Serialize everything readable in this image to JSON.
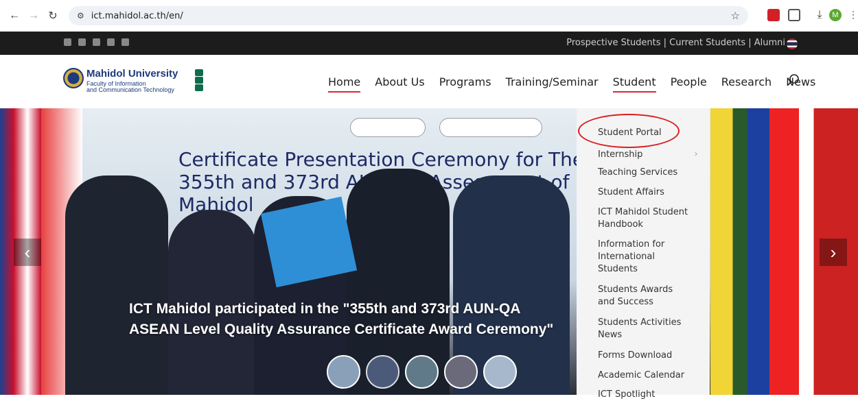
{
  "browser": {
    "url": "ict.mahidol.ac.th/en/",
    "avatar_letter": "M"
  },
  "topbar": {
    "links": "Prospective Students | Current Students | Alumni"
  },
  "logo": {
    "name": "Mahidol University",
    "sub1": "Faculty of Information",
    "sub2": "and Communication Technology"
  },
  "nav": {
    "items": [
      "Home",
      "About Us",
      "Programs",
      "Training/Seminar",
      "Student",
      "People",
      "Research",
      "News"
    ]
  },
  "hero": {
    "banner_text": "Certificate Presentation Ceremony for The 355th and 373rd AUN-QA Assessment of Mahidol",
    "caption_line1": "ICT Mahidol participated in the \"355th and 373rd AUN-QA",
    "caption_line2": "ASEAN Level Quality Assurance Certificate Award Ceremony\""
  },
  "dropdown": {
    "items": [
      "Student Portal",
      "Internship",
      "Teaching Services",
      "Student Affairs",
      "ICT Mahidol Student Handbook",
      "Information for International Students",
      "Students Awards and Success",
      "Students Activities News",
      "Forms Download",
      "Academic Calendar",
      "ICT Spotlight"
    ]
  },
  "colors": {
    "accent": "#d6263b",
    "brand": "#1e3a7b"
  }
}
